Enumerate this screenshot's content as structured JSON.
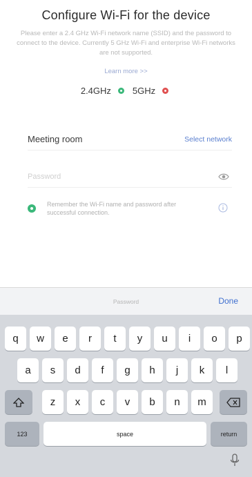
{
  "header": {
    "title": "Configure Wi-Fi for the device",
    "description": "Please enter a 2.4 GHz Wi-Fi network name (SSID) and the password to connect to the device. Currently 5 GHz Wi-Fi and enterprise Wi-Fi networks are not supported.",
    "learn_more": "Learn more >>"
  },
  "bands": {
    "band_24": {
      "label": "2.4GHz",
      "color": "#3bb87a"
    },
    "band_5": {
      "label": "5GHz",
      "color": "#e05050"
    }
  },
  "form": {
    "network_name": "Meeting room",
    "select_network": "Select network",
    "password_value": "",
    "password_placeholder": "Password",
    "remember_text": "Remember the Wi-Fi name and password after successful connection."
  },
  "keyboard": {
    "toolbar_label": "Password",
    "done_label": "Done",
    "rows": [
      [
        "q",
        "w",
        "e",
        "r",
        "t",
        "y",
        "u",
        "i",
        "o",
        "p"
      ],
      [
        "a",
        "s",
        "d",
        "f",
        "g",
        "h",
        "j",
        "k",
        "l"
      ],
      [
        "z",
        "x",
        "c",
        "v",
        "b",
        "n",
        "m"
      ]
    ],
    "numbers_label": "123",
    "space_label": "space",
    "return_label": "return"
  }
}
